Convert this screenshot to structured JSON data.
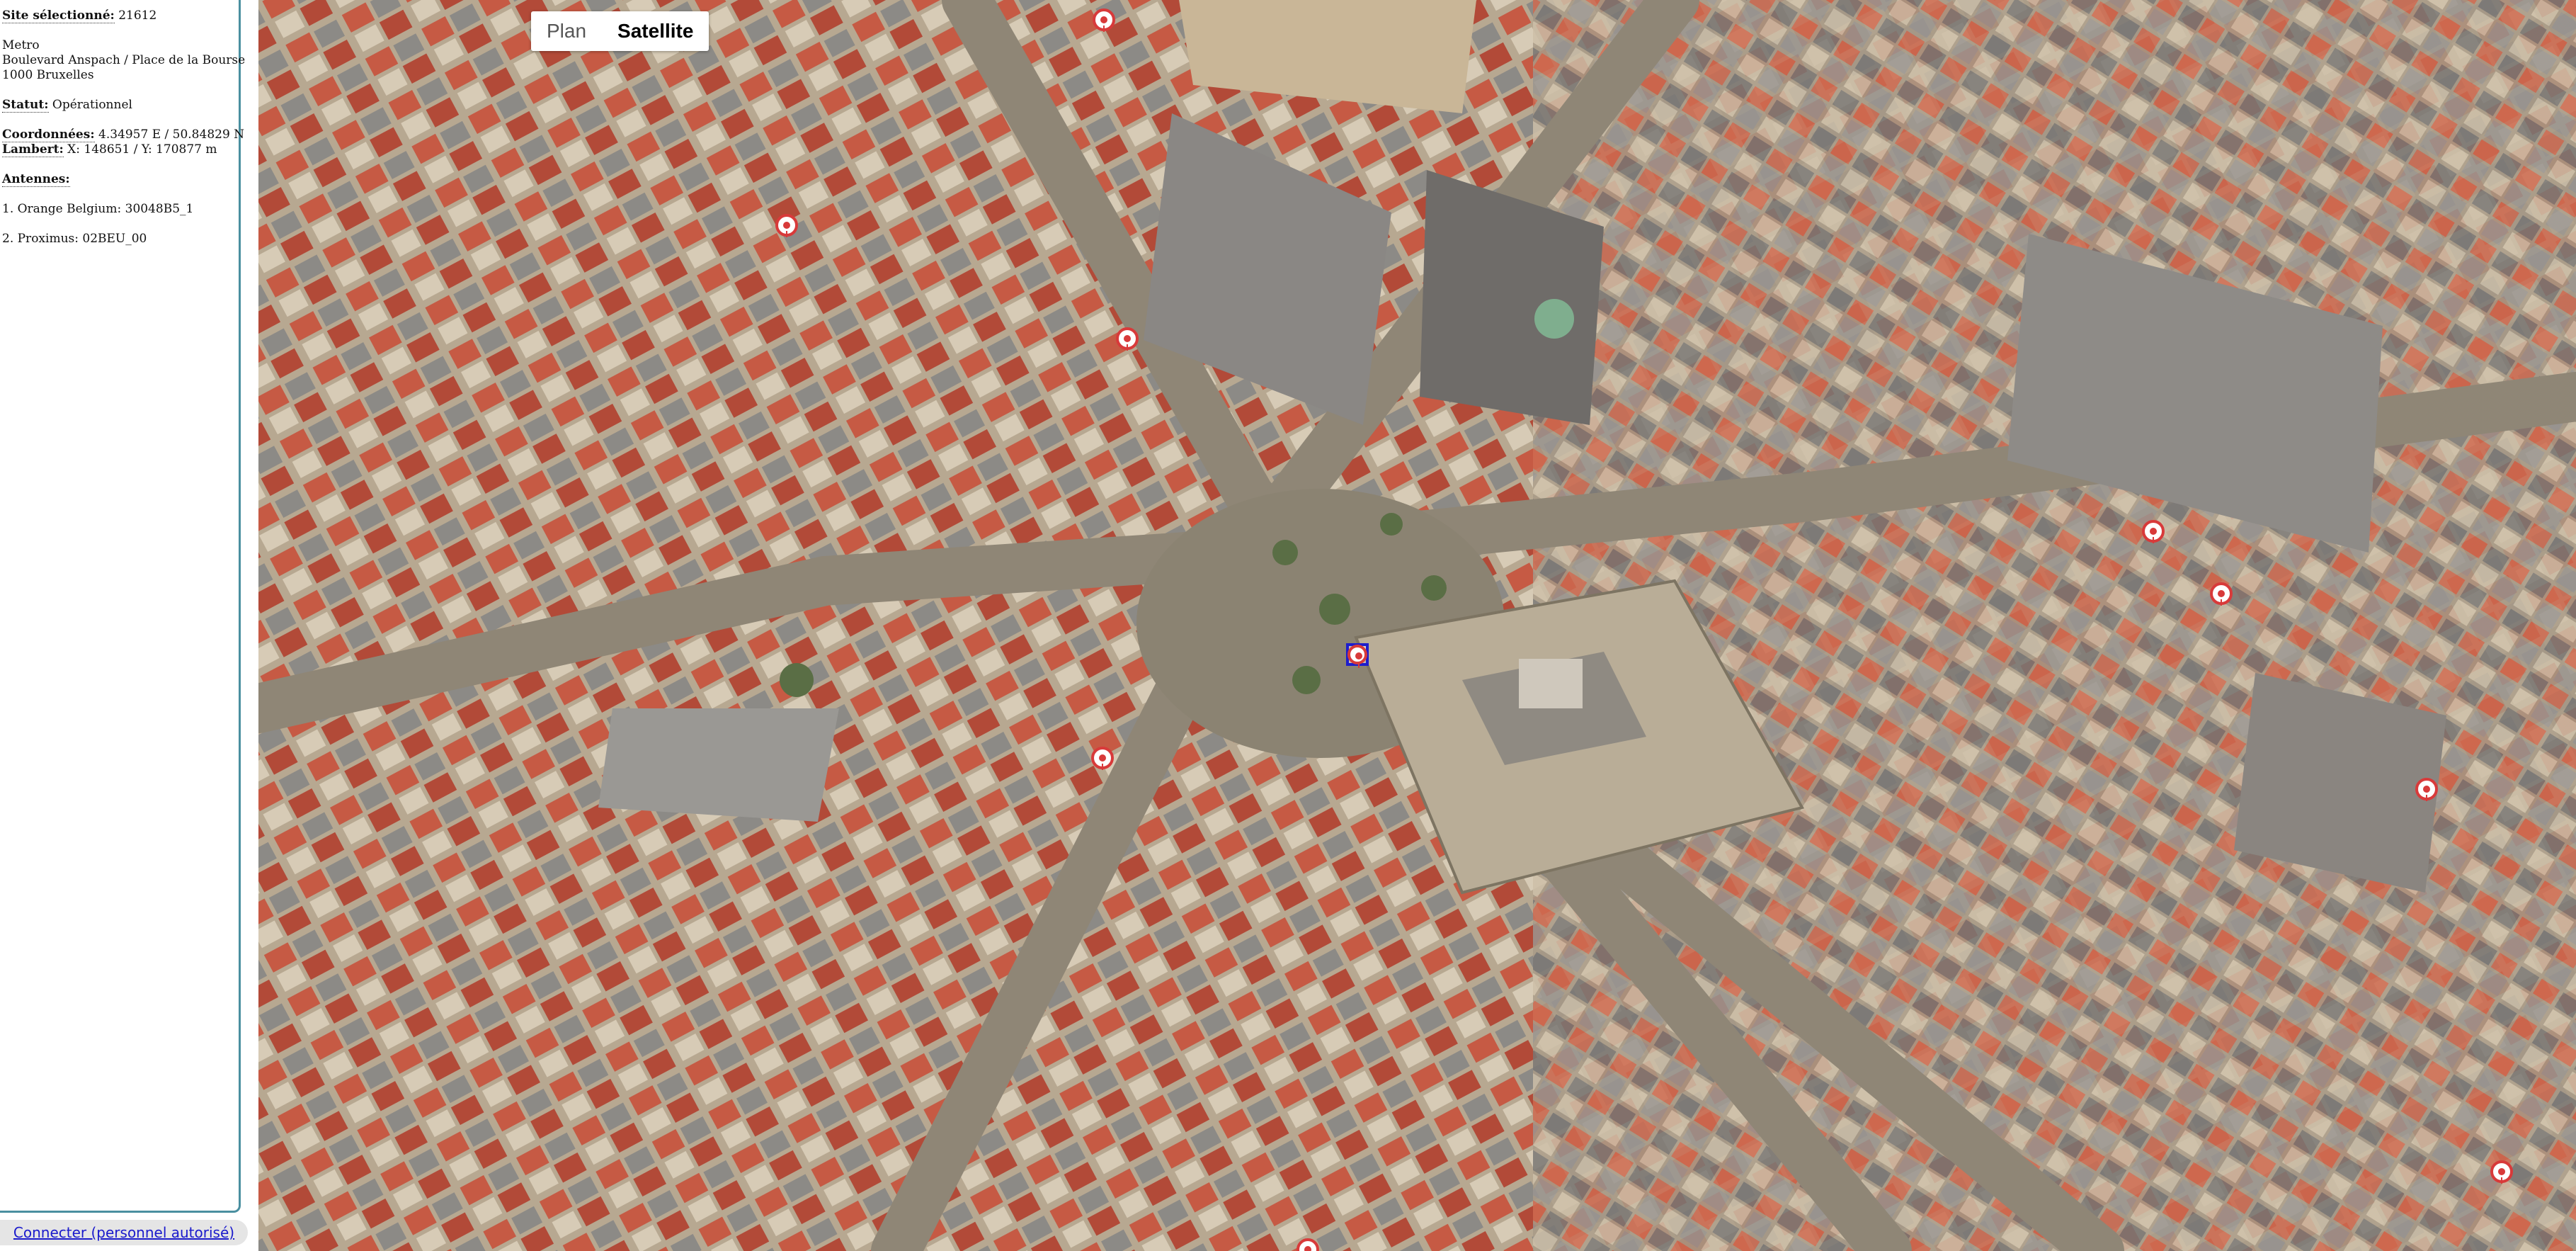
{
  "sidebar": {
    "site_label": "Site sélectionné:",
    "site_id": "21612",
    "type": "Metro",
    "address_line1": "Boulevard Anspach / Place de la Bourse",
    "address_line2": "1000 Bruxelles",
    "status_label": "Statut:",
    "status_value": "Opérationnel",
    "coords_label": "Coordonnées:",
    "coords_value": "4.34957 E / 50.84829 N",
    "lambert_label": "Lambert:",
    "lambert_value": "X: 148651 / Y: 170877 m",
    "antennas_label": "Antennes:",
    "antennas": [
      "1. Orange Belgium: 30048B5_1",
      "2. Proximus: 02BEU_00"
    ]
  },
  "footer": {
    "login_link": "Connecter (personnel autorisé)"
  },
  "map": {
    "type_control": {
      "plan_label": "Plan",
      "satellite_label": "Satellite",
      "selected": "Satellite"
    },
    "imagery": "aerial view of Brussels city centre around Place de la Bourse",
    "marker_icon": "antenna-marker-icon",
    "selected_marker_color": "#1d1dcc",
    "marker_color": "#d83a3a"
  }
}
